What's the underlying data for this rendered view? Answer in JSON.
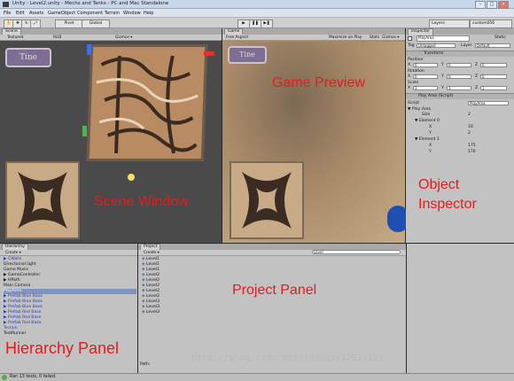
{
  "window": {
    "title": "Unity - Level2.unity - Mechs and Tanks - PC and Mac Standalone"
  },
  "menu": [
    "File",
    "Edit",
    "Assets",
    "GameObject",
    "Component",
    "Terrain",
    "Window",
    "Help"
  ],
  "toolbar": {
    "pivot": "Pivot",
    "global": "Global",
    "play": "▶",
    "pause": "❚❚",
    "step": "▶❚",
    "layers": "Layers",
    "layout": "custom056"
  },
  "scene": {
    "tab": "Scene",
    "textured": "Textured",
    "rgb": "RGB",
    "gizmos": "Gizmos ▾",
    "label": "Scene Window",
    "tile_label": "Tine"
  },
  "game": {
    "tab": "Game",
    "aspect": "Free Aspect",
    "maximize": "Maximize on Play",
    "stats": "Stats",
    "gizmos": "Gizmos ▾",
    "label": "Game Preview",
    "tile_label": "Tine"
  },
  "inspector": {
    "tab": "Inspector",
    "object_name": "PlayArea",
    "static": "Static",
    "tag_label": "Tag",
    "tag_value": "Untagged",
    "layer_label": "Layer",
    "layer_value": "Default",
    "transform": "Transform",
    "position": "Position",
    "rotation": "Rotation",
    "scale": "Scale",
    "pos": [
      "0",
      "0",
      "0"
    ],
    "rot": [
      "0",
      "0",
      "0"
    ],
    "scl": [
      "1",
      "1",
      "1"
    ],
    "script_header": "Play Area (Script)",
    "script_label": "Script",
    "script_value": "PlayArea",
    "play_area": "▼ Play Area",
    "size_label": "Size",
    "size_value": "2",
    "el0": "▼ Element 0",
    "el0x": "10",
    "el0y": "2",
    "el1": "▼ Element 1",
    "el1x": "175",
    "el1y": "170",
    "x": "X",
    "y": "Y",
    "z": "Z",
    "label": "Object Inspector"
  },
  "hierarchy": {
    "tab": "Hierarchy",
    "create": "Create ▾",
    "label": "Hierarchy Panel",
    "items": [
      {
        "t": "▶ CWalls",
        "c": "blue"
      },
      {
        "t": "Directional light",
        "c": ""
      },
      {
        "t": "Game Music",
        "c": ""
      },
      {
        "t": "▶ GameController",
        "c": ""
      },
      {
        "t": "▶ HPath",
        "c": ""
      },
      {
        "t": "Main Camera",
        "c": ""
      },
      {
        "t": "PlayArea",
        "c": "sel"
      },
      {
        "t": "▶ Prefab Blue Base",
        "c": "blue"
      },
      {
        "t": "▶ Prefab Blue Base",
        "c": "blue"
      },
      {
        "t": "▶ Prefab Blue Base",
        "c": "blue"
      },
      {
        "t": "▶ Prefab Red Base",
        "c": "blue"
      },
      {
        "t": "▶ Prefab Red Base",
        "c": "blue"
      },
      {
        "t": "▶ Prefab Red Base",
        "c": "blue"
      },
      {
        "t": "Terrain",
        "c": "blue"
      },
      {
        "t": "TestRunner",
        "c": ""
      }
    ]
  },
  "project": {
    "tab": "Project",
    "create": "Create ▾",
    "search": "Level",
    "path": "Path:",
    "label": "Project Panel",
    "items": [
      "Level1",
      "Level1",
      "Level1",
      "Level2",
      "Level2",
      "Level2",
      "Level2",
      "Level2",
      "Level3",
      "Level3",
      "Level3"
    ]
  },
  "statusbar": {
    "text": "Ran 13 tests, 0 failed."
  },
  "watermark": "http://blog.csdn.net/jojwqzy12611121",
  "colors": {
    "label_red": "#e41c1c",
    "panel_grey": "#c2c2c2",
    "scene_bg": "#4a4a4a"
  }
}
